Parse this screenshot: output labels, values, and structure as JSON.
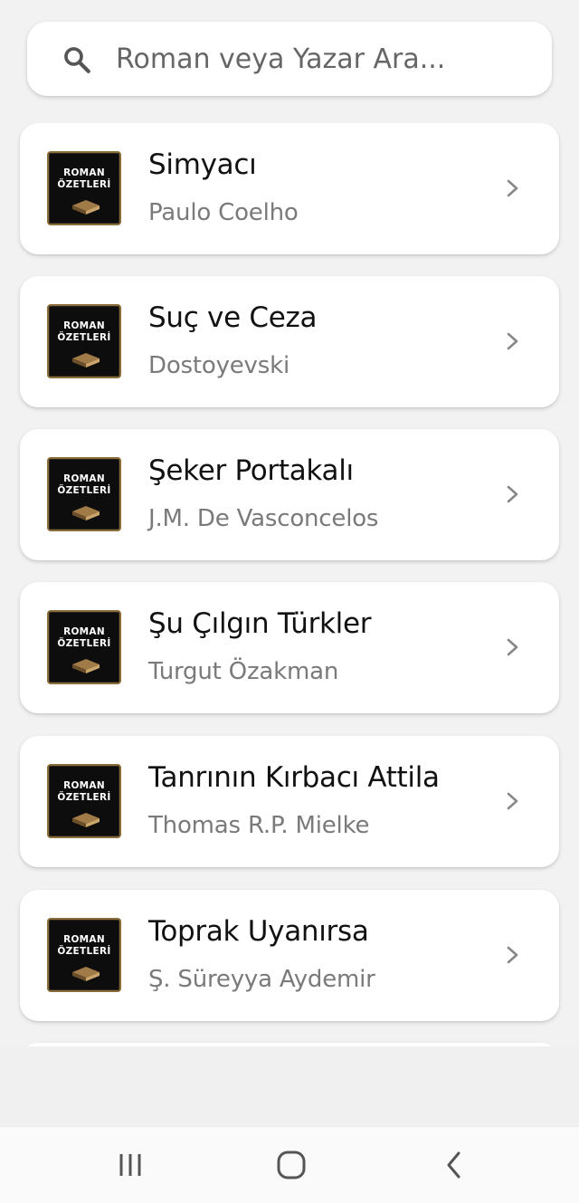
{
  "search": {
    "placeholder": "Roman veya Yazar Ara..."
  },
  "cover_label": {
    "line1": "ROMAN",
    "line2": "ÖZETLERİ"
  },
  "books": [
    {
      "title": "Simyacı",
      "author": "Paulo Coelho"
    },
    {
      "title": "Suç ve Ceza",
      "author": "Dostoyevski"
    },
    {
      "title": "Şeker Portakalı",
      "author": "J.M. De Vasconcelos"
    },
    {
      "title": "Şu Çılgın Türkler",
      "author": "Turgut Özakman"
    },
    {
      "title": "Tanrının Kırbacı Attila",
      "author": "Thomas R.P. Mielke"
    },
    {
      "title": "Toprak Uyanırsa",
      "author": "Ş. Süreyya Aydemir"
    }
  ],
  "colors": {
    "background": "#f2f2f2",
    "card": "#ffffff",
    "title_text": "#111111",
    "author_text": "#7a7a7a",
    "cover_bg": "#0d0d0d",
    "cover_border": "#8a6d3b"
  },
  "icons": {
    "search": "search-icon",
    "chevron": "chevron-right-icon",
    "nav_recent": "recent-apps-icon",
    "nav_home": "home-icon",
    "nav_back": "back-icon"
  }
}
